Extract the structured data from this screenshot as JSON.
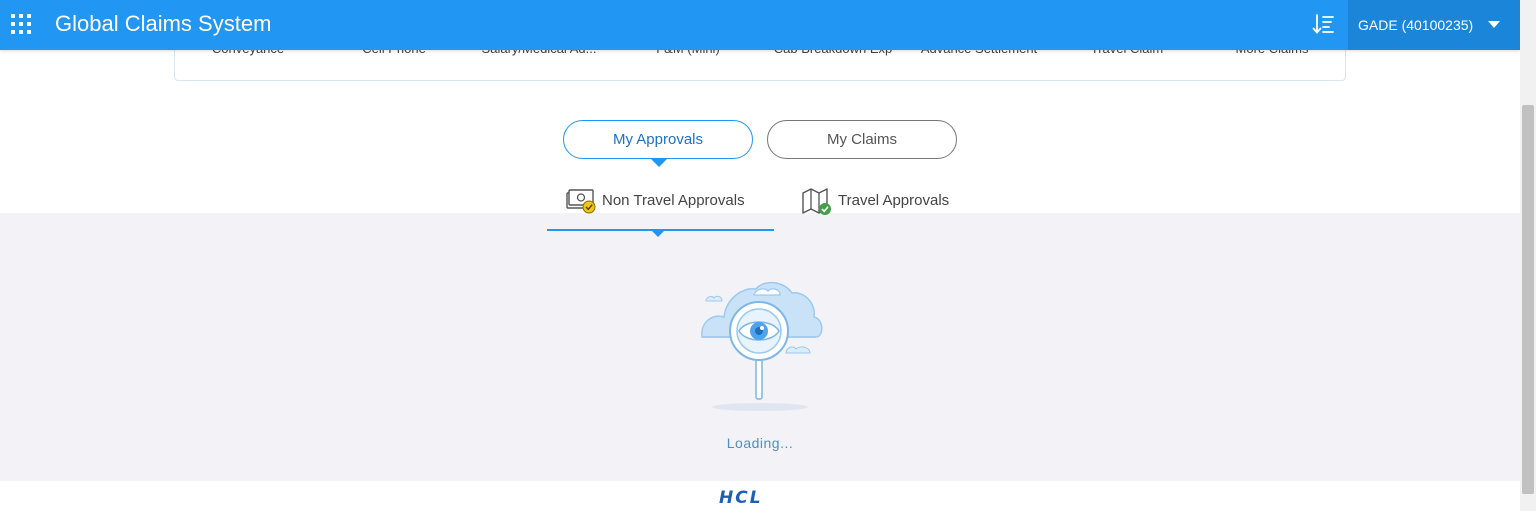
{
  "header": {
    "title": "Global Claims System",
    "user": "GADE (40100235)"
  },
  "claim_types": [
    "Conveyance",
    "Cell Phone",
    "Salary/Medical Ad...",
    "F&M (Mini)",
    "Cab Breakdown Exp",
    "Advance Settlement",
    "Travel Claim",
    "More Claims"
  ],
  "toggles": {
    "my_approvals": "My Approvals",
    "my_claims": "My Claims"
  },
  "subtabs": {
    "non_travel": "Non Travel Approvals",
    "travel": "Travel Approvals"
  },
  "status": {
    "loading": "Loading..."
  },
  "footer": {
    "logo_text": "HCL"
  },
  "colors": {
    "header_bg": "#2196f3",
    "accent": "#2196f3",
    "content_bg": "#f3f3f7",
    "brand": "#1e5fb4"
  }
}
